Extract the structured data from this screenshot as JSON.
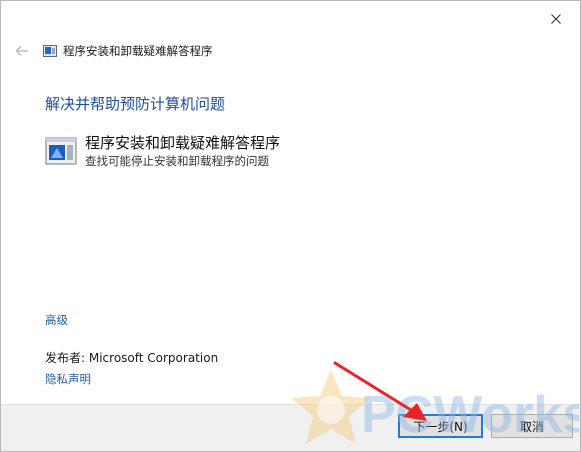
{
  "window": {
    "title": "程序安装和卸载疑难解答程序"
  },
  "heading": "解决并帮助预防计算机问题",
  "item": {
    "title": "程序安装和卸载疑难解答程序",
    "description": "查找可能停止安装和卸载程序的问题"
  },
  "links": {
    "advanced": "高级",
    "privacy": "隐私声明"
  },
  "publisher": "发布者:  Microsoft Corporation",
  "buttons": {
    "next": "下一步(N)",
    "cancel": "取消"
  },
  "watermark_text": "PCWorks",
  "colors": {
    "heading": "#1f4e9c",
    "link": "#1f5fa8",
    "annotation_arrow": "#e8232a",
    "next_focus_border": "#1e7be0"
  }
}
